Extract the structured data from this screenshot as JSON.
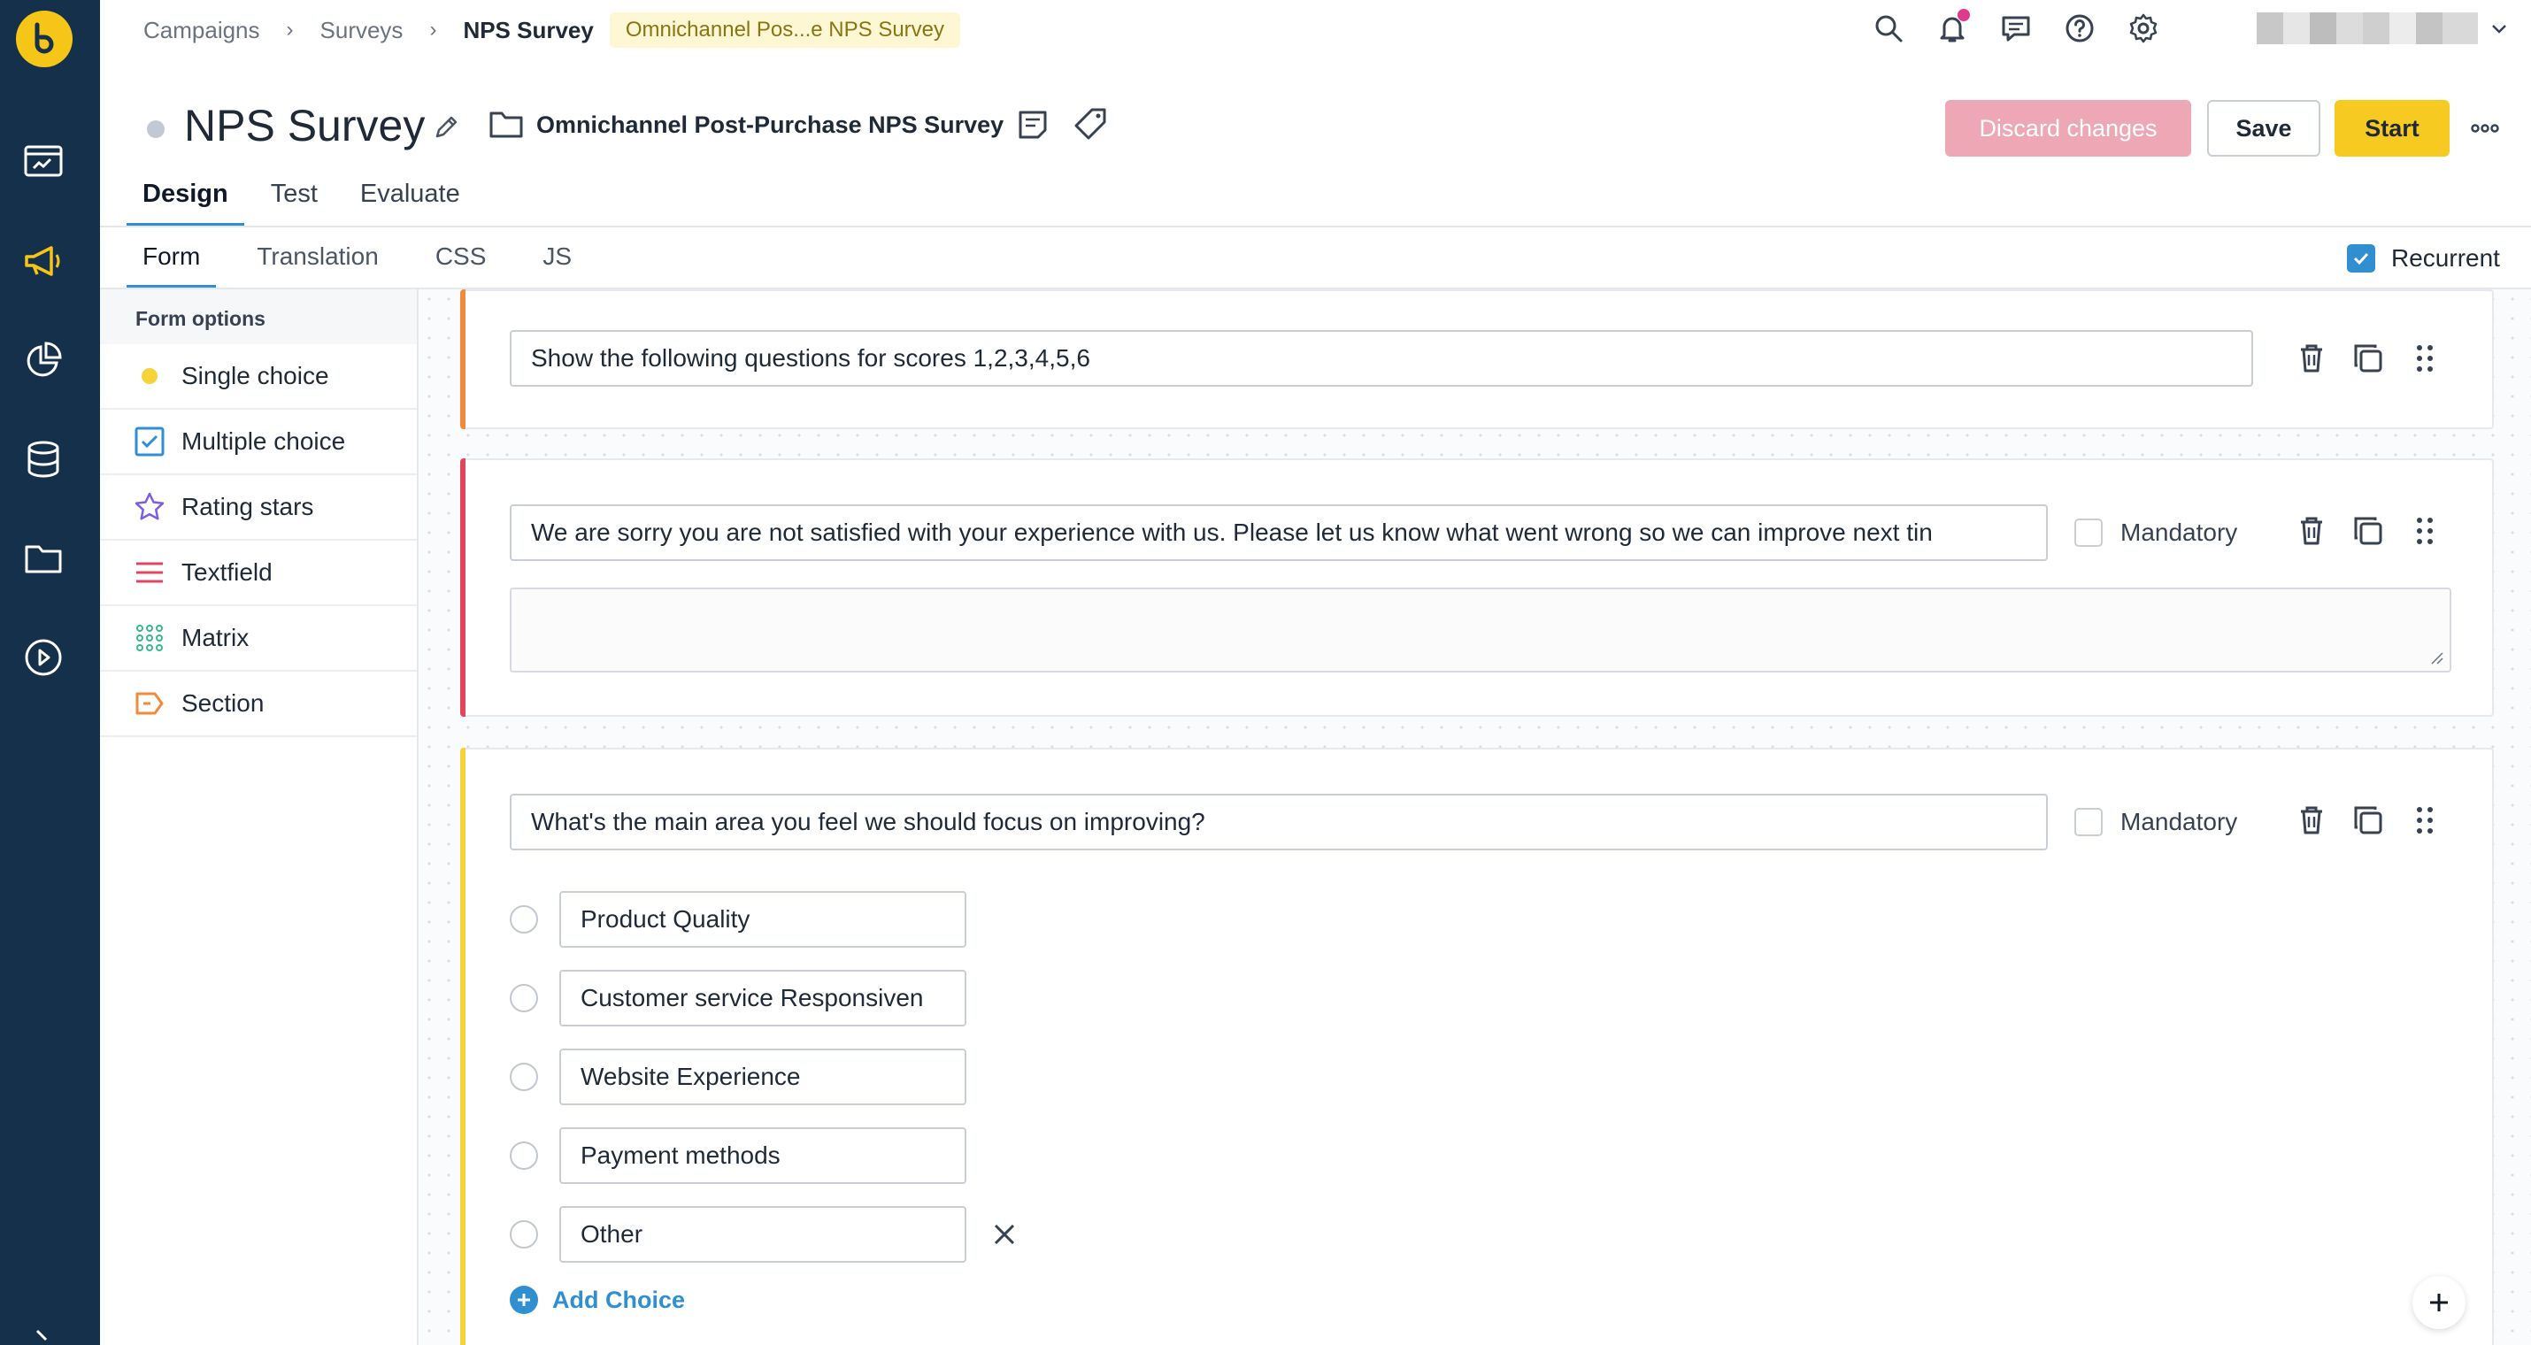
{
  "breadcrumb": {
    "items": [
      "Campaigns",
      "Surveys"
    ],
    "current": "NPS Survey",
    "pill": "Omnichannel Pos...e NPS Survey"
  },
  "header": {
    "title": "NPS Survey",
    "folder_name": "Omnichannel Post-Purchase NPS Survey",
    "discard_label": "Discard changes",
    "save_label": "Save",
    "start_label": "Start"
  },
  "tabs": [
    "Design",
    "Test",
    "Evaluate"
  ],
  "subtabs": [
    "Form",
    "Translation",
    "CSS",
    "JS"
  ],
  "recurrent_label": "Recurrent",
  "options": {
    "header": "Form options",
    "items": [
      "Single choice",
      "Multiple choice",
      "Rating stars",
      "Textfield",
      "Matrix",
      "Section"
    ]
  },
  "cards": {
    "section": {
      "text": "Show the following questions for scores 1,2,3,4,5,6"
    },
    "textfield": {
      "question": "We are sorry you are not satisfied with your experience with us. Please let us know what went wrong so we can improve next tin",
      "mandatory_label": "Mandatory"
    },
    "choice": {
      "question": "What's the main area you feel we should focus on improving?",
      "mandatory_label": "Mandatory",
      "choices": [
        "Product Quality",
        "Customer service Responsiven",
        "Website Experience",
        "Payment methods",
        "Other"
      ],
      "add_label": "Add Choice"
    }
  },
  "colors": {
    "rail": "#15304a",
    "accent_section": "#f08a3c",
    "accent_textfield": "#e0475e",
    "accent_choice": "#f5d33a",
    "primary": "#2f8fd0",
    "start": "#f7ca22",
    "discard": "#eea7b4"
  }
}
